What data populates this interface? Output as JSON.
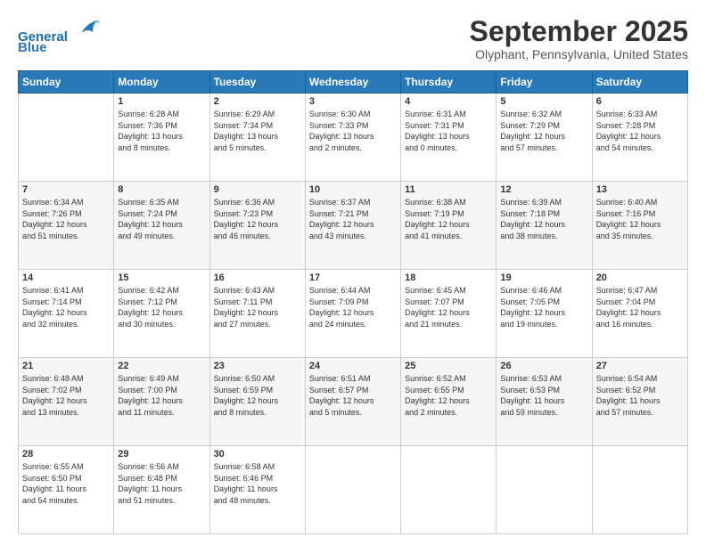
{
  "header": {
    "logo_line1": "General",
    "logo_line2": "Blue",
    "month_title": "September 2025",
    "location": "Olyphant, Pennsylvania, United States"
  },
  "days_of_week": [
    "Sunday",
    "Monday",
    "Tuesday",
    "Wednesday",
    "Thursday",
    "Friday",
    "Saturday"
  ],
  "weeks": [
    [
      {
        "day": "",
        "info": ""
      },
      {
        "day": "1",
        "info": "Sunrise: 6:28 AM\nSunset: 7:36 PM\nDaylight: 13 hours\nand 8 minutes."
      },
      {
        "day": "2",
        "info": "Sunrise: 6:29 AM\nSunset: 7:34 PM\nDaylight: 13 hours\nand 5 minutes."
      },
      {
        "day": "3",
        "info": "Sunrise: 6:30 AM\nSunset: 7:33 PM\nDaylight: 13 hours\nand 2 minutes."
      },
      {
        "day": "4",
        "info": "Sunrise: 6:31 AM\nSunset: 7:31 PM\nDaylight: 13 hours\nand 0 minutes."
      },
      {
        "day": "5",
        "info": "Sunrise: 6:32 AM\nSunset: 7:29 PM\nDaylight: 12 hours\nand 57 minutes."
      },
      {
        "day": "6",
        "info": "Sunrise: 6:33 AM\nSunset: 7:28 PM\nDaylight: 12 hours\nand 54 minutes."
      }
    ],
    [
      {
        "day": "7",
        "info": "Sunrise: 6:34 AM\nSunset: 7:26 PM\nDaylight: 12 hours\nand 51 minutes."
      },
      {
        "day": "8",
        "info": "Sunrise: 6:35 AM\nSunset: 7:24 PM\nDaylight: 12 hours\nand 49 minutes."
      },
      {
        "day": "9",
        "info": "Sunrise: 6:36 AM\nSunset: 7:23 PM\nDaylight: 12 hours\nand 46 minutes."
      },
      {
        "day": "10",
        "info": "Sunrise: 6:37 AM\nSunset: 7:21 PM\nDaylight: 12 hours\nand 43 minutes."
      },
      {
        "day": "11",
        "info": "Sunrise: 6:38 AM\nSunset: 7:19 PM\nDaylight: 12 hours\nand 41 minutes."
      },
      {
        "day": "12",
        "info": "Sunrise: 6:39 AM\nSunset: 7:18 PM\nDaylight: 12 hours\nand 38 minutes."
      },
      {
        "day": "13",
        "info": "Sunrise: 6:40 AM\nSunset: 7:16 PM\nDaylight: 12 hours\nand 35 minutes."
      }
    ],
    [
      {
        "day": "14",
        "info": "Sunrise: 6:41 AM\nSunset: 7:14 PM\nDaylight: 12 hours\nand 32 minutes."
      },
      {
        "day": "15",
        "info": "Sunrise: 6:42 AM\nSunset: 7:12 PM\nDaylight: 12 hours\nand 30 minutes."
      },
      {
        "day": "16",
        "info": "Sunrise: 6:43 AM\nSunset: 7:11 PM\nDaylight: 12 hours\nand 27 minutes."
      },
      {
        "day": "17",
        "info": "Sunrise: 6:44 AM\nSunset: 7:09 PM\nDaylight: 12 hours\nand 24 minutes."
      },
      {
        "day": "18",
        "info": "Sunrise: 6:45 AM\nSunset: 7:07 PM\nDaylight: 12 hours\nand 21 minutes."
      },
      {
        "day": "19",
        "info": "Sunrise: 6:46 AM\nSunset: 7:05 PM\nDaylight: 12 hours\nand 19 minutes."
      },
      {
        "day": "20",
        "info": "Sunrise: 6:47 AM\nSunset: 7:04 PM\nDaylight: 12 hours\nand 16 minutes."
      }
    ],
    [
      {
        "day": "21",
        "info": "Sunrise: 6:48 AM\nSunset: 7:02 PM\nDaylight: 12 hours\nand 13 minutes."
      },
      {
        "day": "22",
        "info": "Sunrise: 6:49 AM\nSunset: 7:00 PM\nDaylight: 12 hours\nand 11 minutes."
      },
      {
        "day": "23",
        "info": "Sunrise: 6:50 AM\nSunset: 6:59 PM\nDaylight: 12 hours\nand 8 minutes."
      },
      {
        "day": "24",
        "info": "Sunrise: 6:51 AM\nSunset: 6:57 PM\nDaylight: 12 hours\nand 5 minutes."
      },
      {
        "day": "25",
        "info": "Sunrise: 6:52 AM\nSunset: 6:55 PM\nDaylight: 12 hours\nand 2 minutes."
      },
      {
        "day": "26",
        "info": "Sunrise: 6:53 AM\nSunset: 6:53 PM\nDaylight: 11 hours\nand 59 minutes."
      },
      {
        "day": "27",
        "info": "Sunrise: 6:54 AM\nSunset: 6:52 PM\nDaylight: 11 hours\nand 57 minutes."
      }
    ],
    [
      {
        "day": "28",
        "info": "Sunrise: 6:55 AM\nSunset: 6:50 PM\nDaylight: 11 hours\nand 54 minutes."
      },
      {
        "day": "29",
        "info": "Sunrise: 6:56 AM\nSunset: 6:48 PM\nDaylight: 11 hours\nand 51 minutes."
      },
      {
        "day": "30",
        "info": "Sunrise: 6:58 AM\nSunset: 6:46 PM\nDaylight: 11 hours\nand 48 minutes."
      },
      {
        "day": "",
        "info": ""
      },
      {
        "day": "",
        "info": ""
      },
      {
        "day": "",
        "info": ""
      },
      {
        "day": "",
        "info": ""
      }
    ]
  ]
}
